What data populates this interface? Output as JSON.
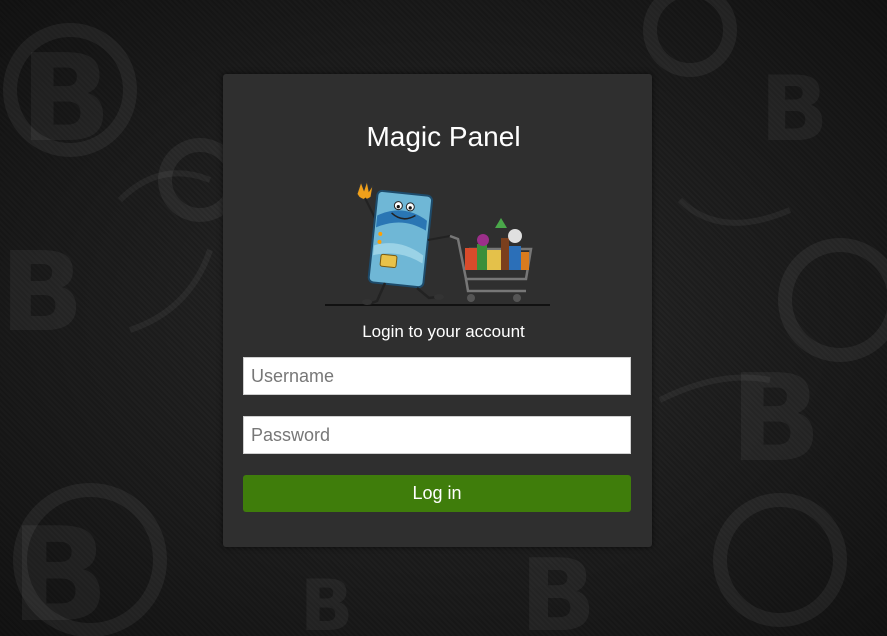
{
  "login": {
    "title": "Magic Panel",
    "subtitle": "Login to your account",
    "username_placeholder": "Username",
    "password_placeholder": "Password",
    "button_label": "Log in"
  },
  "illustration": {
    "icon": "credit-card-shopping-cart-mascot-icon"
  },
  "colors": {
    "page_background": "#262626",
    "panel_background": "#2f2f2f",
    "button_background": "#3f7d0b",
    "text": "#ffffff"
  }
}
